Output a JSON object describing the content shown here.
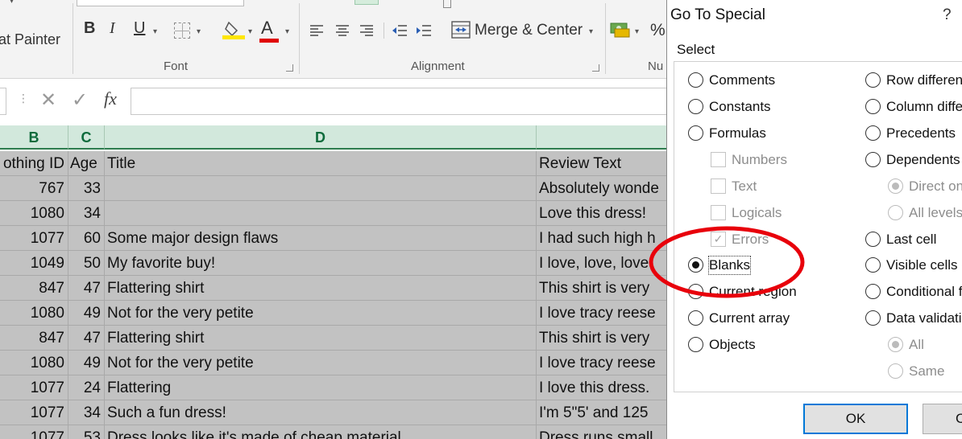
{
  "ribbon": {
    "format_painter": "at Painter",
    "bold": "B",
    "italic": "I",
    "underline": "U",
    "font_color_letter": "A",
    "merge_center": "Merge & Center",
    "percent": "%",
    "group_font": "Font",
    "group_alignment": "Alignment",
    "group_number": "Nu",
    "colors": {
      "highlight_yellow": "#ffe600",
      "font_red": "#e00000",
      "excel_green": "#217346"
    }
  },
  "formula_bar": {
    "fx_label": "fx",
    "cancel_glyph": "✕",
    "enter_glyph": "✓",
    "value": ""
  },
  "grid": {
    "columns": [
      "B",
      "C",
      "D"
    ],
    "header_row": {
      "b": "othing ID",
      "c": "Age",
      "d": "Title",
      "e": "Review Text"
    },
    "rows": [
      {
        "b": "767",
        "c": "33",
        "d": "",
        "e": "Absolutely wonde"
      },
      {
        "b": "1080",
        "c": "34",
        "d": "",
        "e": "Love this dress!"
      },
      {
        "b": "1077",
        "c": "60",
        "d": "Some major design flaws",
        "e": "I had such high h"
      },
      {
        "b": "1049",
        "c": "50",
        "d": "My favorite buy!",
        "e": "I love, love, love"
      },
      {
        "b": "847",
        "c": "47",
        "d": "Flattering shirt",
        "e": "This shirt is very"
      },
      {
        "b": "1080",
        "c": "49",
        "d": "Not for the very petite",
        "e": "I love tracy reese"
      },
      {
        "b": "847",
        "c": "47",
        "d": "Flattering shirt",
        "e": "This shirt is very"
      },
      {
        "b": "1080",
        "c": "49",
        "d": "Not for the very petite",
        "e": "I love tracy reese"
      },
      {
        "b": "1077",
        "c": "24",
        "d": "Flattering",
        "e": "I love this dress."
      },
      {
        "b": "1077",
        "c": "34",
        "d": "Such a fun dress!",
        "e": "I'm 5\"5' and 125"
      },
      {
        "b": "1077",
        "c": "53",
        "d": "Dress looks like it's made of cheap material",
        "e": "Dress runs small"
      }
    ]
  },
  "dialog": {
    "title": "Go To Special",
    "help": "?",
    "group_label": "Select",
    "left_options": [
      {
        "label": "Comments",
        "kind": "radio",
        "checked": false,
        "disabled": false
      },
      {
        "label": "Constants",
        "kind": "radio",
        "checked": false,
        "disabled": false
      },
      {
        "label": "Formulas",
        "kind": "radio",
        "checked": false,
        "disabled": false
      },
      {
        "label": "Numbers",
        "kind": "check",
        "checked": false,
        "disabled": true
      },
      {
        "label": "Text",
        "kind": "check",
        "checked": false,
        "disabled": true
      },
      {
        "label": "Logicals",
        "kind": "check",
        "checked": false,
        "disabled": true
      },
      {
        "label": "Errors",
        "kind": "check",
        "checked": true,
        "disabled": true
      },
      {
        "label": "Blanks",
        "kind": "radio",
        "checked": true,
        "disabled": false
      },
      {
        "label": "Current region",
        "kind": "radio",
        "checked": false,
        "disabled": false
      },
      {
        "label": "Current array",
        "kind": "radio",
        "checked": false,
        "disabled": false
      },
      {
        "label": "Objects",
        "kind": "radio",
        "checked": false,
        "disabled": false
      }
    ],
    "right_options": [
      {
        "label": "Row differen",
        "kind": "radio",
        "checked": false,
        "disabled": false
      },
      {
        "label": "Column diffe",
        "kind": "radio",
        "checked": false,
        "disabled": false
      },
      {
        "label": "Precedents",
        "kind": "radio",
        "checked": false,
        "disabled": false
      },
      {
        "label": "Dependents",
        "kind": "radio",
        "checked": false,
        "disabled": false
      },
      {
        "label": "Direct on",
        "kind": "radio",
        "checked": true,
        "disabled": true
      },
      {
        "label": "All levels",
        "kind": "radio",
        "checked": false,
        "disabled": true
      },
      {
        "label": "Last cell",
        "kind": "radio",
        "checked": false,
        "disabled": false
      },
      {
        "label": "Visible cells o",
        "kind": "radio",
        "checked": false,
        "disabled": false
      },
      {
        "label": "Conditional f",
        "kind": "radio",
        "checked": false,
        "disabled": false
      },
      {
        "label": "Data validatio",
        "kind": "radio",
        "checked": false,
        "disabled": false
      },
      {
        "label": "All",
        "kind": "radio",
        "checked": true,
        "disabled": true
      },
      {
        "label": "Same",
        "kind": "radio",
        "checked": false,
        "disabled": true
      }
    ],
    "ok_label": "OK",
    "cancel_label": "C",
    "annotation_color": "#e8000b"
  }
}
